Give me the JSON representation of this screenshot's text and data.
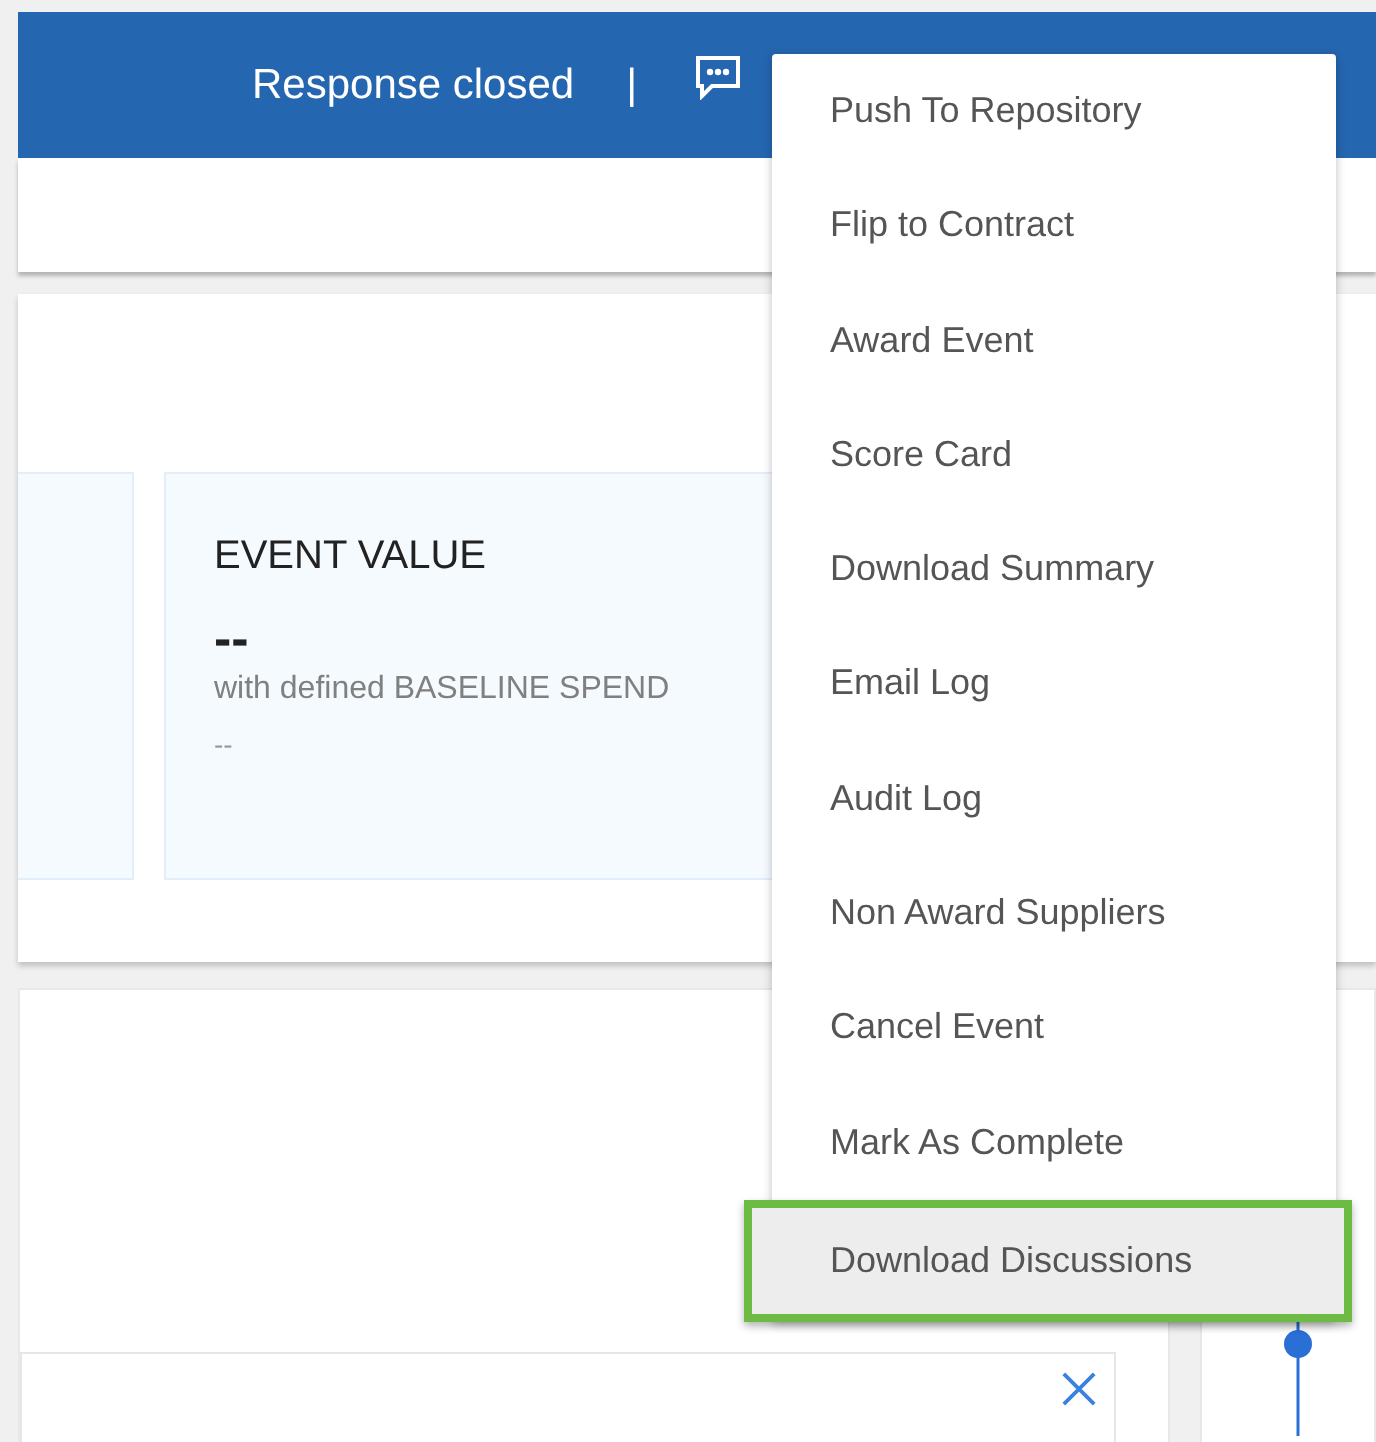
{
  "header": {
    "status": "Response closed",
    "separator": "|"
  },
  "summary": {
    "tiles": [
      {
        "title": "EVENT VALUE",
        "value": "--",
        "caption": "with defined BASELINE SPEND",
        "detail": "--"
      }
    ]
  },
  "menu": {
    "items": [
      {
        "label": "Push To Repository",
        "selected": false
      },
      {
        "label": "Flip to Contract",
        "selected": false
      },
      {
        "label": "Award Event",
        "selected": false
      },
      {
        "label": "Score Card",
        "selected": false
      },
      {
        "label": "Download Summary",
        "selected": false
      },
      {
        "label": "Email Log",
        "selected": false
      },
      {
        "label": "Audit Log",
        "selected": false
      },
      {
        "label": "Non Award Suppliers",
        "selected": false
      },
      {
        "label": "Cancel Event",
        "selected": false
      },
      {
        "label": "Mark As Complete",
        "selected": false
      },
      {
        "label": "Download Discussions",
        "selected": true
      }
    ]
  }
}
